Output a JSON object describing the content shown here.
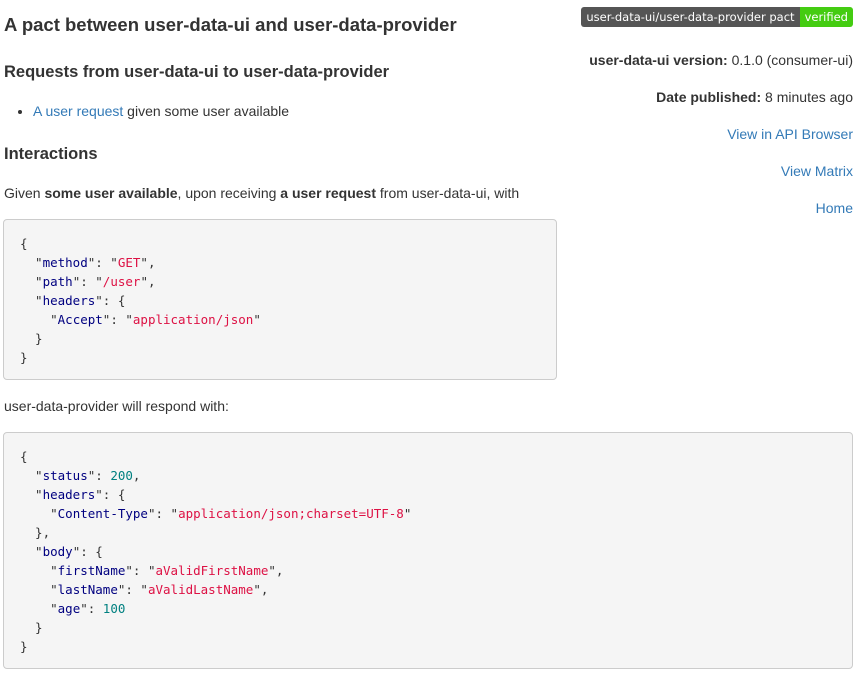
{
  "title": "A pact between user-data-ui and user-data-provider",
  "badge": {
    "left": "user-data-ui/user-data-provider pact",
    "right": "verified",
    "right_color": "#44cc11"
  },
  "meta": {
    "consumer_label": "user-data-ui version:",
    "consumer_value": "0.1.0 (consumer-ui)",
    "date_label": "Date published:",
    "date_value": "8 minutes ago",
    "links": [
      "View in API Browser",
      "View Matrix",
      "Home"
    ]
  },
  "requests": {
    "heading": "Requests from user-data-ui to user-data-provider",
    "items": [
      {
        "link": "A user request",
        "rest": "given some user available"
      }
    ]
  },
  "interactions": {
    "heading": "Interactions",
    "given_prefix": "Given",
    "given_state": "some user available",
    "given_mid": ", upon receiving",
    "given_desc": "a user request",
    "given_suffix": "from user-data-ui, with",
    "request": {
      "method": "GET",
      "path": "/user",
      "headers": {
        "Accept": "application/json"
      }
    },
    "response_intro": "user-data-provider will respond with:",
    "response": {
      "status": 200,
      "headers": {
        "Content-Type": "application/json;charset=UTF-8"
      },
      "body": {
        "firstName": "aValidFirstName",
        "lastName": "aValidLastName",
        "age": 100
      }
    }
  }
}
